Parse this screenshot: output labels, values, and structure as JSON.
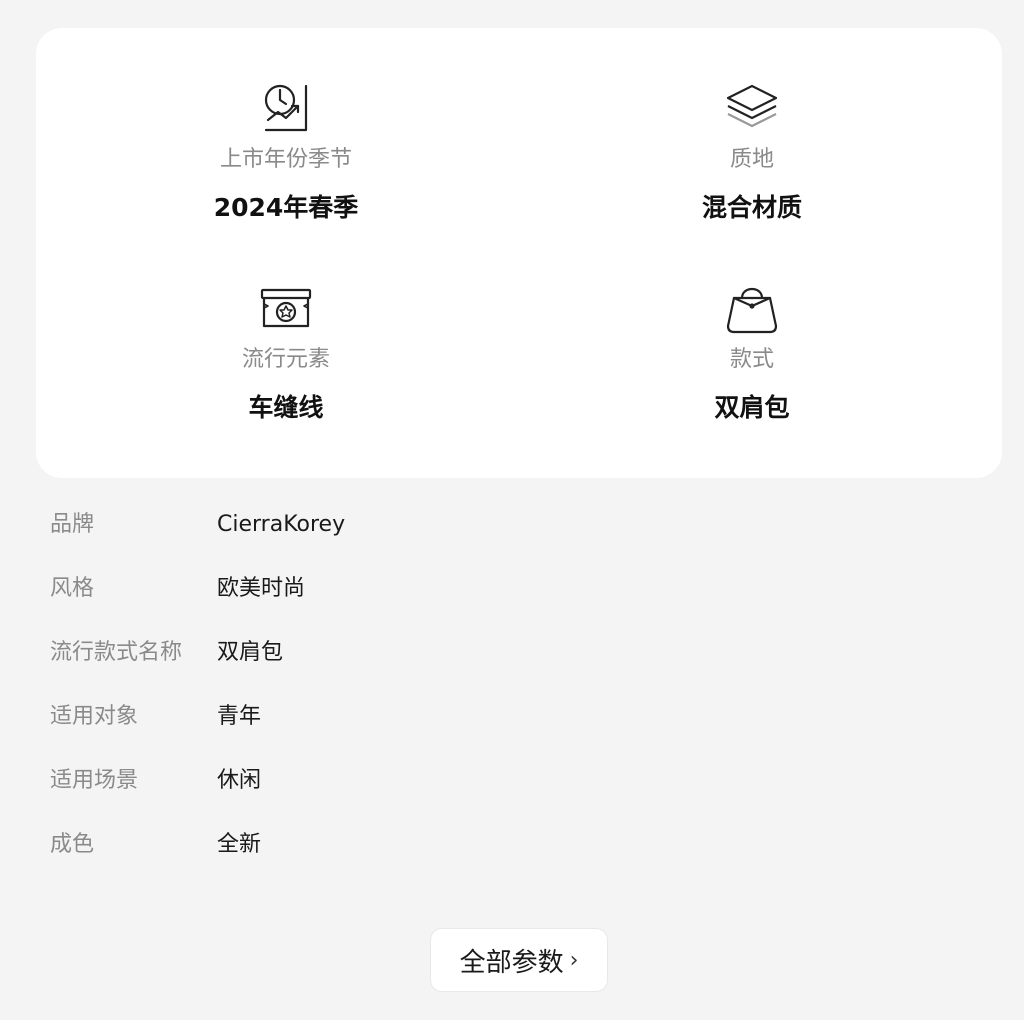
{
  "features": [
    {
      "icon": "calendar-chart-icon",
      "label": "上市年份季节",
      "value": "2024年春季"
    },
    {
      "icon": "layers-icon",
      "label": "质地",
      "value": "混合材质"
    },
    {
      "icon": "badge-box-icon",
      "label": "流行元素",
      "value": "车缝线"
    },
    {
      "icon": "handbag-icon",
      "label": "款式",
      "value": "双肩包"
    }
  ],
  "specs": [
    {
      "key": "品牌",
      "value": "CierraKorey"
    },
    {
      "key": "风格",
      "value": "欧美时尚"
    },
    {
      "key": "流行款式名称",
      "value": "双肩包"
    },
    {
      "key": "适用对象",
      "value": "青年"
    },
    {
      "key": "适用场景",
      "value": "休闲"
    },
    {
      "key": "成色",
      "value": "全新"
    }
  ],
  "all_params": {
    "label": "全部参数",
    "chevron": "›"
  },
  "colors": {
    "background": "#f4f4f4",
    "card": "#ffffff",
    "label_gray": "#8a8a8a",
    "value_dark": "#111111"
  }
}
